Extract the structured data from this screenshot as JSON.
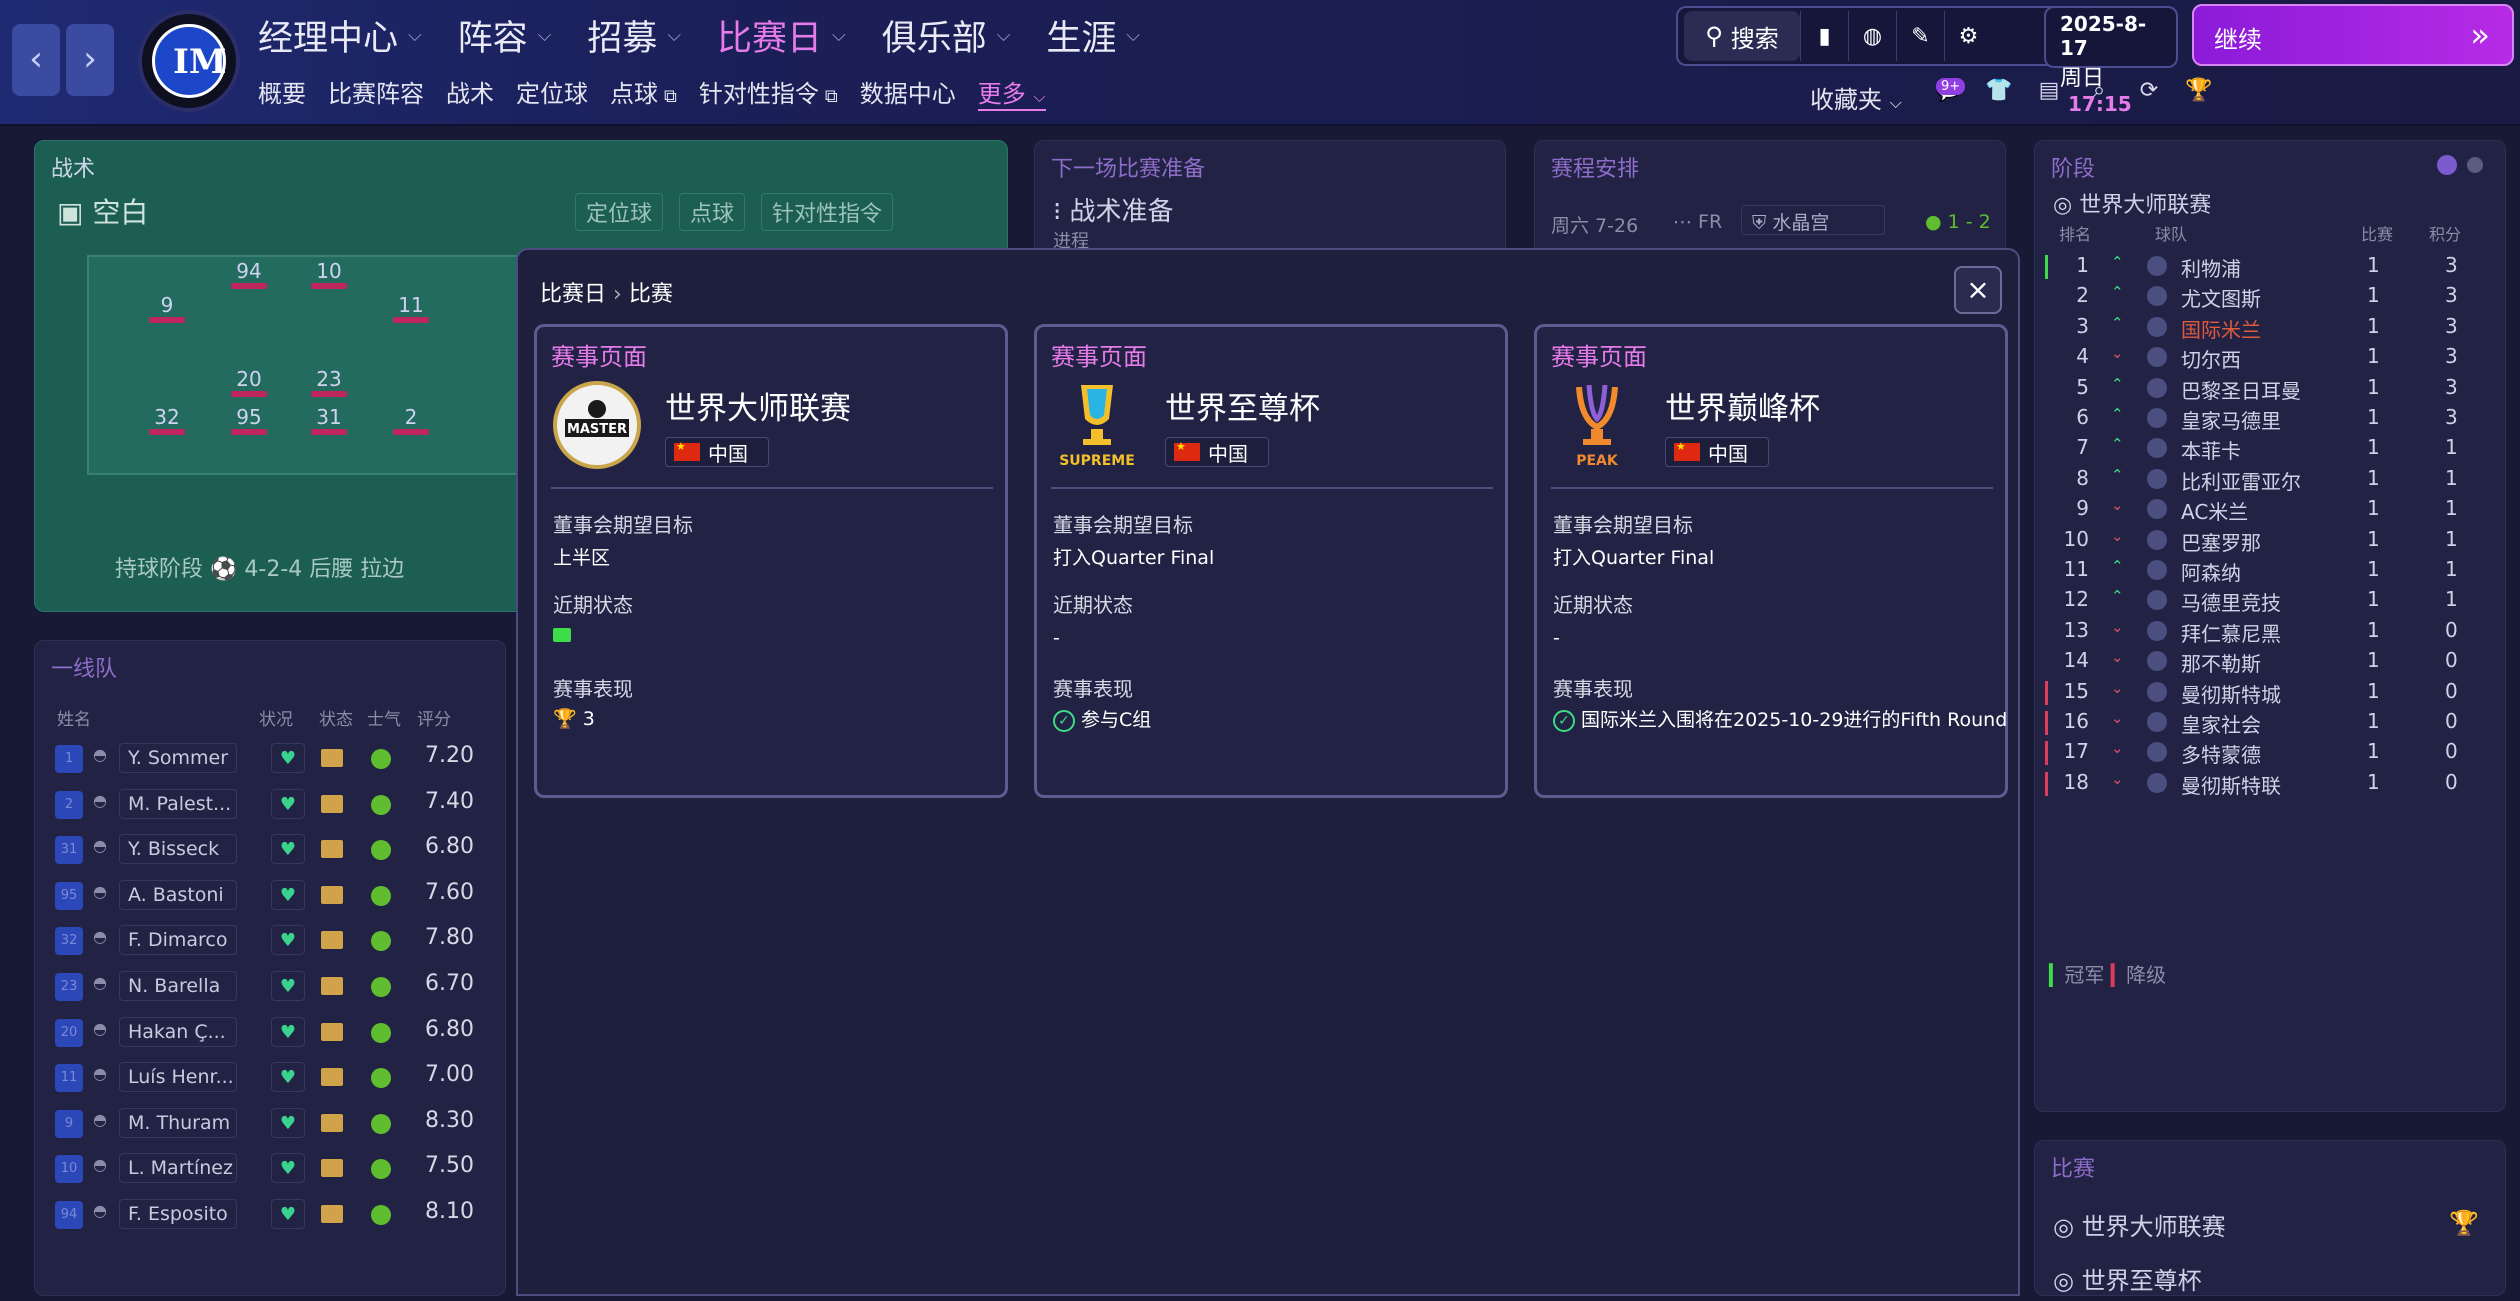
{
  "header": {
    "nav_prev": "‹",
    "nav_next": "›",
    "club_logo": "IM",
    "main_nav": [
      "经理中心",
      "阵容",
      "招募",
      "比赛日",
      "俱乐部",
      "生涯"
    ],
    "sub_nav": [
      "概要",
      "比赛阵容",
      "战术",
      "定位球",
      "点球",
      "针对性指令",
      "数据中心",
      "更多"
    ],
    "search_label": "搜索",
    "date": "2025-8-17",
    "weekday": "周日",
    "time": "17:15",
    "continue_label": "继续",
    "favorites_label": "收藏夹",
    "notif_badge": "9+"
  },
  "tactics_panel": {
    "title": "战术",
    "name": "空白",
    "tabs": [
      "定位球",
      "点球",
      "针对性指令"
    ],
    "phase_label": "持球阶段",
    "formation": "4-2-4 后腰 拉边",
    "players": [
      "94",
      "10",
      "9",
      "11",
      "20",
      "23",
      "32",
      "95",
      "31",
      "2"
    ]
  },
  "next_match_panel": {
    "title": "下一场比赛准备",
    "sub": "战术准备",
    "progress": "进程"
  },
  "schedule_panel": {
    "title": "赛程安排",
    "date": "周六 7-26",
    "venue": "FR",
    "opponent": "水晶宫",
    "score": "1 - 2"
  },
  "squad_panel": {
    "title": "一线队",
    "headers": [
      "姓名",
      "状况",
      "状态",
      "士气",
      "评分"
    ],
    "players": [
      {
        "num": "1",
        "name": "Y. Sommer",
        "rating": "7.20"
      },
      {
        "num": "2",
        "name": "M. Palest...",
        "rating": "7.40"
      },
      {
        "num": "31",
        "name": "Y. Bisseck",
        "rating": "6.80"
      },
      {
        "num": "95",
        "name": "A. Bastoni",
        "rating": "7.60"
      },
      {
        "num": "32",
        "name": "F. Dimarco",
        "rating": "7.80"
      },
      {
        "num": "23",
        "name": "N. Barella",
        "rating": "6.70"
      },
      {
        "num": "20",
        "name": "Hakan Ç...",
        "rating": "6.80"
      },
      {
        "num": "11",
        "name": "Luís Henr...",
        "rating": "7.00"
      },
      {
        "num": "9",
        "name": "M. Thuram",
        "rating": "8.30"
      },
      {
        "num": "10",
        "name": "L. Martínez",
        "rating": "7.50"
      },
      {
        "num": "94",
        "name": "F. Esposito",
        "rating": "8.10"
      }
    ]
  },
  "stage_panel": {
    "title": "阶段",
    "competition": "世界大师联赛",
    "headers": [
      "排名",
      "球队",
      "比赛",
      "积分"
    ],
    "rows": [
      {
        "rank": "1",
        "team": "利物浦",
        "played": "1",
        "pts": "3",
        "trend": "up"
      },
      {
        "rank": "2",
        "team": "尤文图斯",
        "played": "1",
        "pts": "3",
        "trend": "up"
      },
      {
        "rank": "3",
        "team": "国际米兰",
        "played": "1",
        "pts": "3",
        "trend": "up"
      },
      {
        "rank": "4",
        "team": "切尔西",
        "played": "1",
        "pts": "3",
        "trend": "down"
      },
      {
        "rank": "5",
        "team": "巴黎圣日耳曼",
        "played": "1",
        "pts": "3",
        "trend": "up"
      },
      {
        "rank": "6",
        "team": "皇家马德里",
        "played": "1",
        "pts": "3",
        "trend": "up"
      },
      {
        "rank": "7",
        "team": "本菲卡",
        "played": "1",
        "pts": "1",
        "trend": "up"
      },
      {
        "rank": "8",
        "team": "比利亚雷亚尔",
        "played": "1",
        "pts": "1",
        "trend": "up"
      },
      {
        "rank": "9",
        "team": "AC米兰",
        "played": "1",
        "pts": "1",
        "trend": "down"
      },
      {
        "rank": "10",
        "team": "巴塞罗那",
        "played": "1",
        "pts": "1",
        "trend": "down"
      },
      {
        "rank": "11",
        "team": "阿森纳",
        "played": "1",
        "pts": "1",
        "trend": "up"
      },
      {
        "rank": "12",
        "team": "马德里竞技",
        "played": "1",
        "pts": "1",
        "trend": "up"
      },
      {
        "rank": "13",
        "team": "拜仁慕尼黑",
        "played": "1",
        "pts": "0",
        "trend": "down"
      },
      {
        "rank": "14",
        "team": "那不勒斯",
        "played": "1",
        "pts": "0",
        "trend": "down"
      },
      {
        "rank": "15",
        "team": "曼彻斯特城",
        "played": "1",
        "pts": "0",
        "trend": "down"
      },
      {
        "rank": "16",
        "team": "皇家社会",
        "played": "1",
        "pts": "0",
        "trend": "down"
      },
      {
        "rank": "17",
        "team": "多特蒙德",
        "played": "1",
        "pts": "0",
        "trend": "down"
      },
      {
        "rank": "18",
        "team": "曼彻斯特联",
        "played": "1",
        "pts": "0",
        "trend": "down"
      }
    ],
    "legend_champion": "冠军",
    "legend_relegation": "降级"
  },
  "matches_panel": {
    "title": "比赛",
    "items": [
      "世界大师联赛",
      "世界至尊杯"
    ]
  },
  "modal": {
    "breadcrumb_parent": "比赛日",
    "breadcrumb_current": "比赛",
    "close": "×",
    "cards": [
      {
        "header": "赛事页面",
        "name": "世界大师联赛",
        "logo_text": "MASTER",
        "nation": "中国",
        "board_label": "董事会期望目标",
        "board_value": "上半区",
        "form_label": "近期状态",
        "form_value": "",
        "perf_label": "赛事表现",
        "perf_value": "3"
      },
      {
        "header": "赛事页面",
        "name": "世界至尊杯",
        "logo_text": "SUPREME",
        "nation": "中国",
        "board_label": "董事会期望目标",
        "board_value": "打入Quarter Final",
        "form_label": "近期状态",
        "form_value": "-",
        "perf_label": "赛事表现",
        "perf_value": "参与C组"
      },
      {
        "header": "赛事页面",
        "name": "世界巅峰杯",
        "logo_text": "PEAK",
        "nation": "中国",
        "board_label": "董事会期望目标",
        "board_value": "打入Quarter Final",
        "form_label": "近期状态",
        "form_value": "-",
        "perf_label": "赛事表现",
        "perf_value": "国际米兰入围将在2025-10-29进行的Fifth Round"
      }
    ]
  },
  "colors": {
    "accent": "#e67bea",
    "continue": "#a324e0",
    "pitch": "#1d5e53",
    "positive": "#3ddc84"
  }
}
